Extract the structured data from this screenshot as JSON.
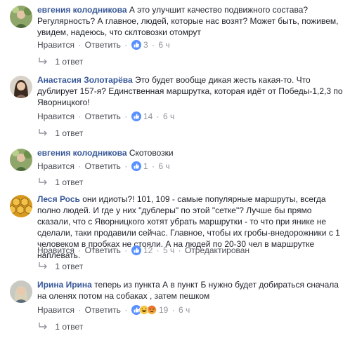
{
  "actions": {
    "like": "Нравится",
    "reply": "Ответить",
    "dot": "·"
  },
  "colors": {
    "author": "#385898",
    "meta": "#90949c",
    "like_blue": "#5890ff"
  },
  "comments": [
    {
      "author": "евгения колодникова",
      "text": "А это улучшит качество подвижного состава? Регулярность? А главное, людей, которые нас возят? Может быть, поживем, увидем, надеюсь, что склтовозки отомрут",
      "reactions": [
        "like-icon"
      ],
      "count": "3",
      "time": "6 ч",
      "replies": "1 ответ"
    },
    {
      "author": "Анастасия Золотарёва",
      "text": "Это будет вообще дикая жесть какая-то. Что дублирует 157-я? Единственная маршрутка, которая идёт от Победы-1,2,3 по Яворницкого!",
      "reactions": [
        "like-icon"
      ],
      "count": "14",
      "time": "6 ч",
      "replies": "1 ответ"
    },
    {
      "author": "евгения колодникова",
      "text": "Скотовозки",
      "reactions": [
        "like-icon"
      ],
      "count": "1",
      "time": "6 ч",
      "replies": "1 ответ"
    },
    {
      "author": "Леся Рось",
      "text": "они идиоты?! 101, 109 - самые популярные маршруты, всегда полно людей. И где у них \"дублеры\" по этой \"сетке\"? Лучше бы прямо сказали, что с Яворницкого хотят убрать маршрутки - то что при янике не сделали, таки продавили сейчас. Главное, чтобы их гробы-внедорожники с 1 человеком в пробках не стояли. А на людей по 20-30 чел в маршрутке наплевать.",
      "reactions": [
        "like-icon"
      ],
      "count": "12",
      "time": "5 ч",
      "edited": "Отредактирован",
      "replies": "1 ответ"
    },
    {
      "author": "Ирина Ирина",
      "text": "теперь из пункта А в пункт Б нужно будет добираться сначала на оленях потом на собаках , затем пешком",
      "reactions": [
        "like-icon",
        "haha-icon",
        "angry-icon"
      ],
      "count": "19",
      "time": "6 ч",
      "replies": "1 ответ"
    }
  ]
}
